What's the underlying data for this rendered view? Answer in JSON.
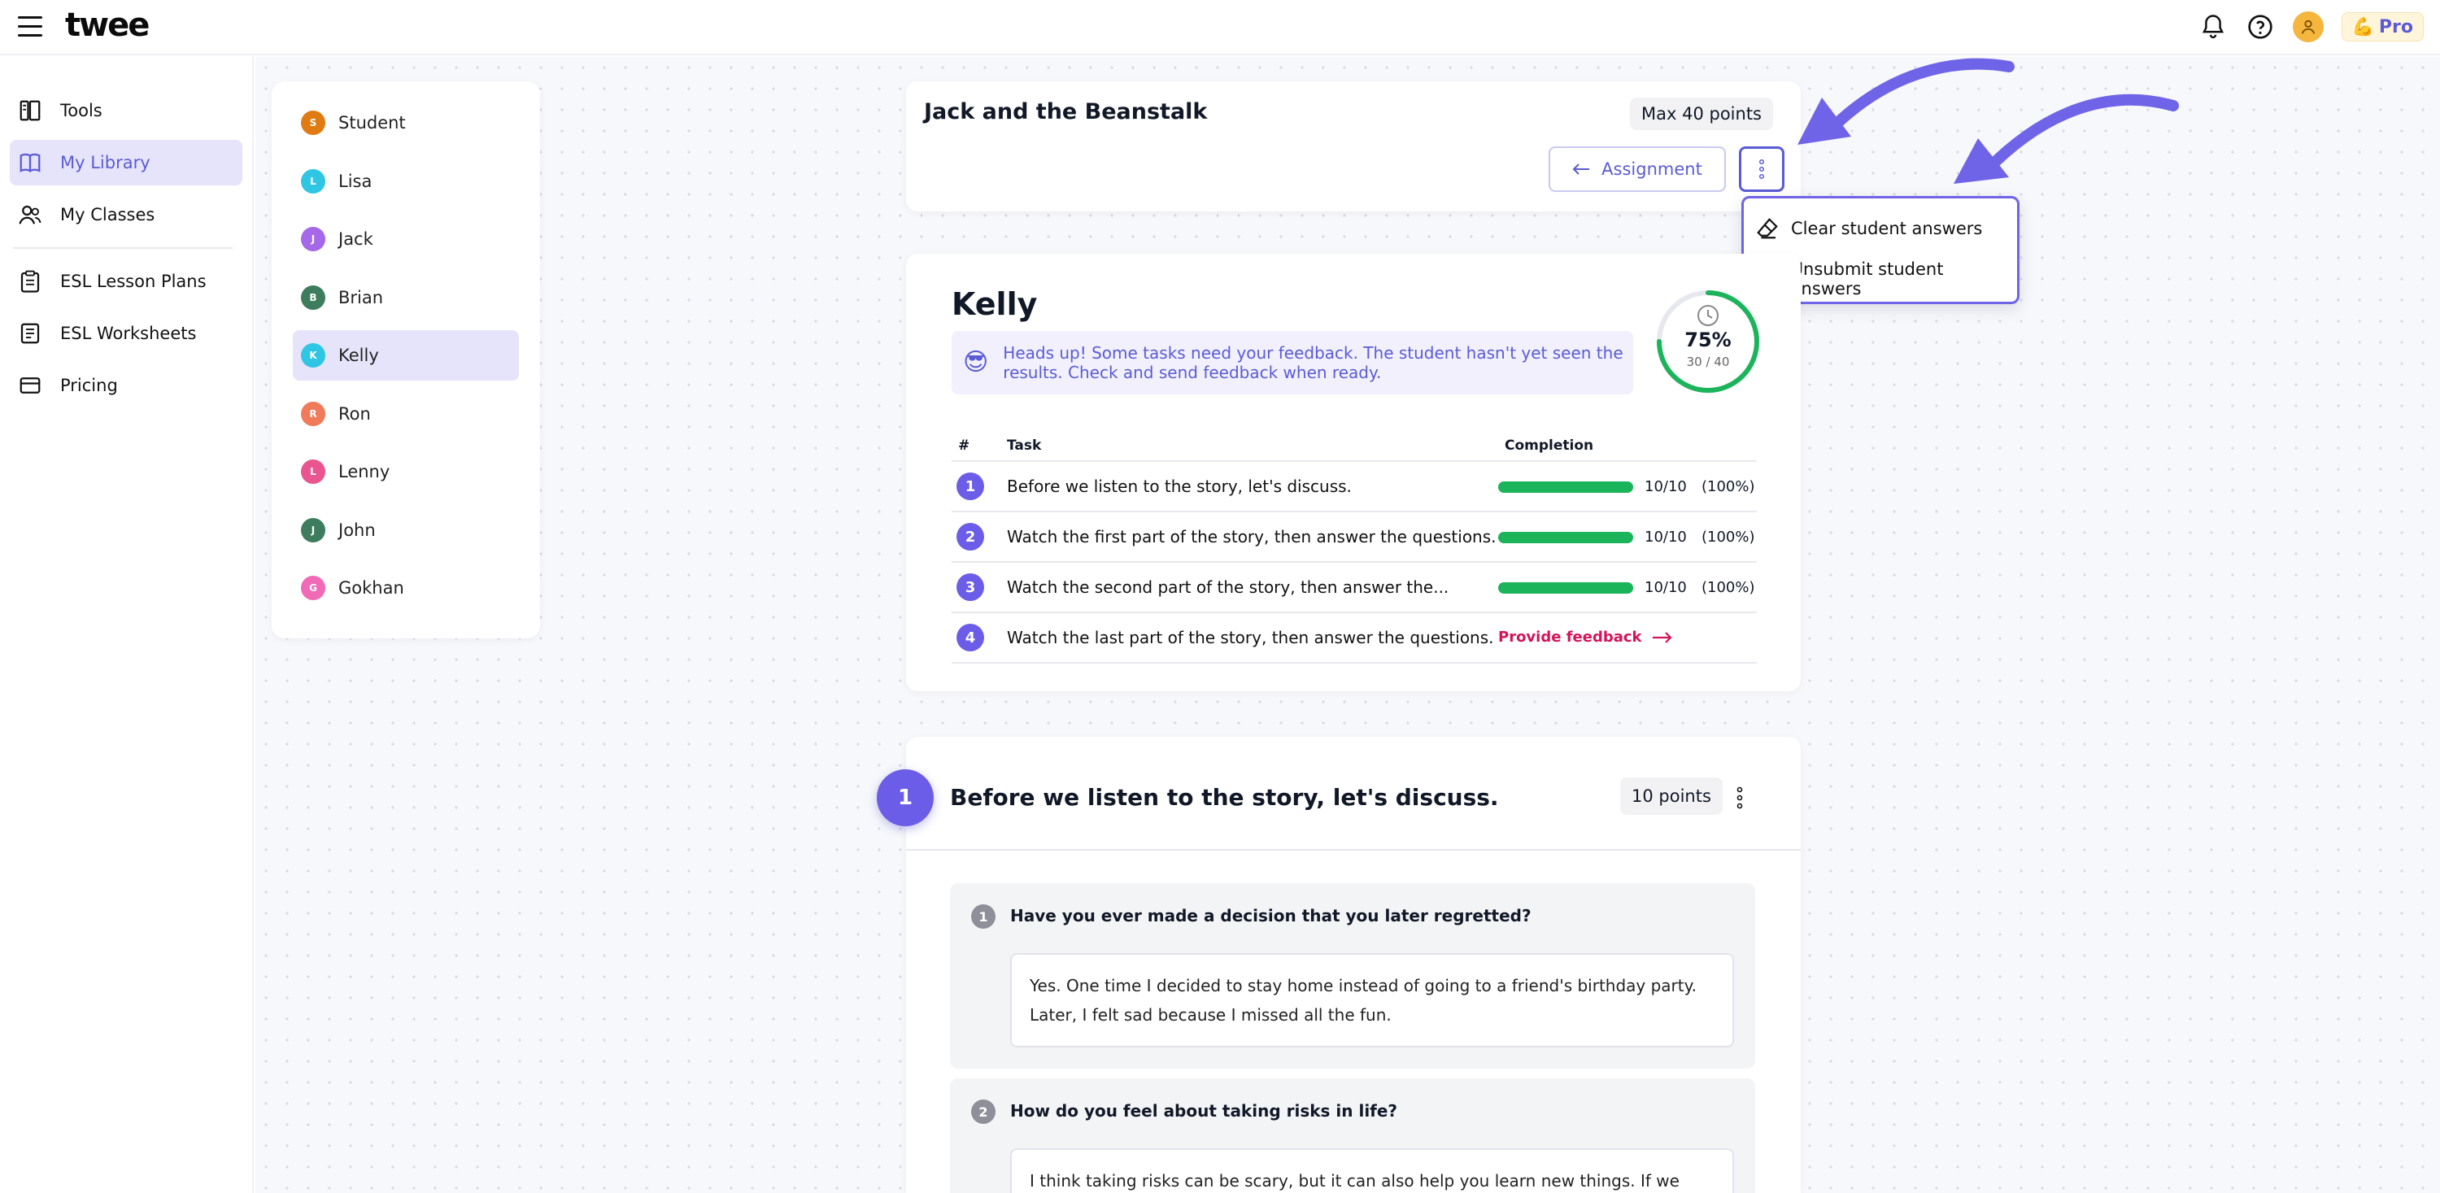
{
  "app": {
    "logo": "twee"
  },
  "topbar": {
    "pro_label": "Pro"
  },
  "sidebar": {
    "items": [
      {
        "label": "Tools"
      },
      {
        "label": "My Library"
      },
      {
        "label": "My Classes"
      },
      {
        "label": "ESL Lesson Plans"
      },
      {
        "label": "ESL Worksheets"
      },
      {
        "label": "Pricing"
      }
    ]
  },
  "students": [
    {
      "initial": "S",
      "name": "Student",
      "color": "#e07b12"
    },
    {
      "initial": "L",
      "name": "Lisa",
      "color": "#2fc6e4"
    },
    {
      "initial": "J",
      "name": "Jack",
      "color": "#a468e8"
    },
    {
      "initial": "B",
      "name": "Brian",
      "color": "#3d7c5c"
    },
    {
      "initial": "K",
      "name": "Kelly",
      "color": "#2fc6e4"
    },
    {
      "initial": "R",
      "name": "Ron",
      "color": "#f07a5a"
    },
    {
      "initial": "L",
      "name": "Lenny",
      "color": "#e9558f"
    },
    {
      "initial": "J",
      "name": "John",
      "color": "#3d7c5c"
    },
    {
      "initial": "G",
      "name": "Gokhan",
      "color": "#f06ab8"
    }
  ],
  "assignment": {
    "title": "Jack and the Beanstalk",
    "max_points": "Max 40 points",
    "assignment_button": "Assignment"
  },
  "menu": {
    "items": [
      {
        "label": "Clear student answers"
      },
      {
        "label": "Unsubmit student answers"
      }
    ]
  },
  "student_card": {
    "name": "Kelly",
    "alert_emoji": "😎",
    "alert_line1": "Heads up! Some tasks need your feedback. The student hasn't yet seen the",
    "alert_line2": "results. Check and send feedback when ready.",
    "score_percent": "75%",
    "score_fraction": "30 / 40",
    "progress": 0.75,
    "headers": {
      "num": "#",
      "task": "Task",
      "completion": "Completion"
    },
    "tasks": [
      {
        "num": "1",
        "text": "Before we listen to the story, let's discuss.",
        "score": "10/10",
        "pct": "(100%)",
        "completion": 1.0
      },
      {
        "num": "2",
        "text": "Watch the first part of the story, then answer the questions.",
        "score": "10/10",
        "pct": "(100%)",
        "completion": 1.0
      },
      {
        "num": "3",
        "text": "Watch the second part of the story, then answer the...",
        "score": "10/10",
        "pct": "(100%)",
        "completion": 1.0
      },
      {
        "num": "4",
        "text": "Watch the last part of the story, then answer the questions.",
        "feedback": "Provide feedback"
      }
    ]
  },
  "section": {
    "number": "1",
    "title": "Before we listen to the story, let's discuss.",
    "points": "10 points",
    "questions": [
      {
        "num": "1",
        "text": "Have you ever made a decision that you later regretted?",
        "answer_line1": "Yes. One time I decided to stay home instead of going to a friend's birthday party.",
        "answer_line2": "Later, I felt sad because I missed all the fun."
      },
      {
        "num": "2",
        "text": "How do you feel about taking risks in life?",
        "answer_line1": "I think taking risks can be scary, but it can also help you learn new things. If we"
      }
    ]
  },
  "colors": {
    "accent": "#5b5bd6",
    "success": "#1cb45b",
    "feedback": "#d4145a"
  }
}
